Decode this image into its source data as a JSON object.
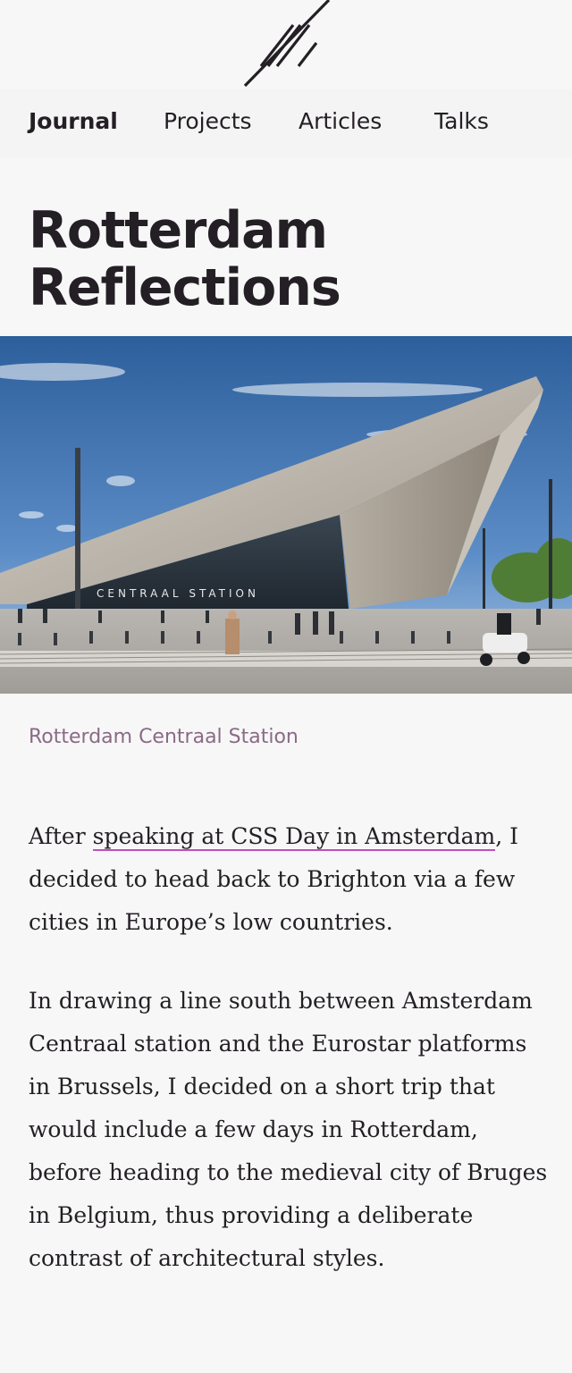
{
  "site": {
    "logo": "logo-mark-icon"
  },
  "nav": {
    "items": [
      {
        "label": "Journal",
        "active": true
      },
      {
        "label": "Projects",
        "active": false
      },
      {
        "label": "Articles",
        "active": false
      },
      {
        "label": "Talks",
        "active": false
      }
    ]
  },
  "article": {
    "title_line1": "Rotterdam",
    "title_line2": "Reflections",
    "hero_sign": "CENTRAAL STATION",
    "caption": "Rotterdam Centraal Station",
    "p1_before": "After ",
    "p1_link": "speaking at CSS Day in Amsterdam",
    "p1_after": ", I decided to head back to Brighton via a few cities in Europe’s low countries.",
    "p2": "In drawing a line south between Amsterdam Centraal station and the Eurostar platforms in Brussels, I decided on a short trip that would include a few days in Rotterdam, before heading to the medieval city of Bruges in Belgium, thus providing a deliberate contrast of architectural styles."
  },
  "colors": {
    "link_underline": "#c04ec0",
    "caption": "#8a6a86",
    "text": "#231f24"
  }
}
